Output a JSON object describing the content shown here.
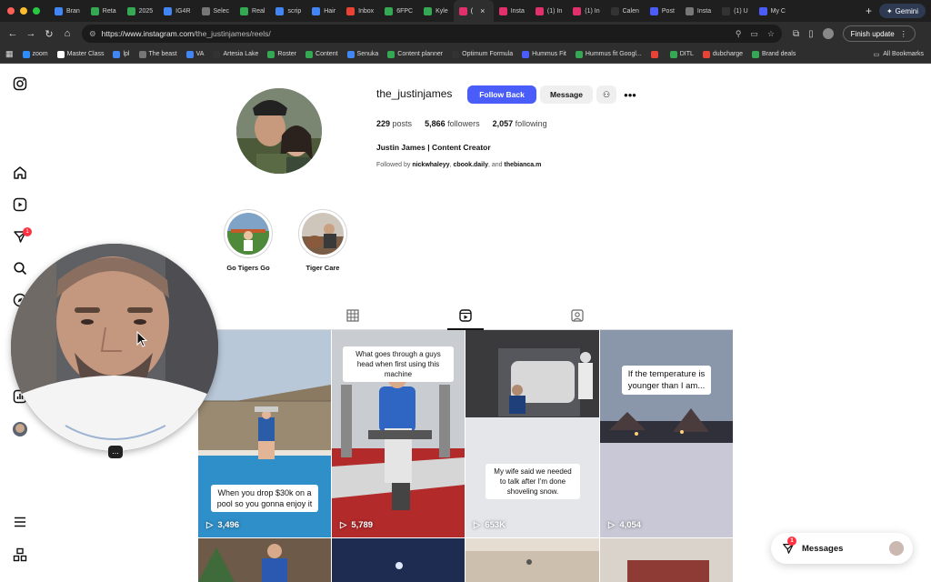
{
  "browser": {
    "tabs": [
      {
        "label": "Bran",
        "color": "#4285f4"
      },
      {
        "label": "Reta",
        "color": "#34a853"
      },
      {
        "label": "2025",
        "color": "#34a853"
      },
      {
        "label": "IG4R",
        "color": "#4285f4"
      },
      {
        "label": "Selec",
        "color": "#777777"
      },
      {
        "label": "Real",
        "color": "#34a853"
      },
      {
        "label": "scrip",
        "color": "#4285f4"
      },
      {
        "label": "Hair",
        "color": "#4285f4"
      },
      {
        "label": "Inbox",
        "color": "#ea4335"
      },
      {
        "label": "6FPC",
        "color": "#34a853"
      },
      {
        "label": "Kyle",
        "color": "#34a853"
      },
      {
        "label": "(",
        "color": "#e1306c"
      },
      {
        "label": "Insta",
        "color": "#e1306c"
      },
      {
        "label": "(1) In",
        "color": "#e1306c"
      },
      {
        "label": "(1) In",
        "color": "#e1306c"
      },
      {
        "label": "Calen",
        "color": "#333333"
      },
      {
        "label": "Post",
        "color": "#4a5df9"
      },
      {
        "label": "Insta",
        "color": "#777777"
      },
      {
        "label": "(1) U",
        "color": "#333333"
      },
      {
        "label": "My C",
        "color": "#4a5df9"
      }
    ],
    "active_tab_index": 11,
    "gemini_label": "Gemini",
    "url_prefix": "https://www.instagram.com",
    "url_path": "/the_justinjames/reels/",
    "finish_update_label": "Finish update",
    "bookmarks": [
      {
        "label": "zoom",
        "color": "#2d8cff"
      },
      {
        "label": "Master Class",
        "color": "#ffffff"
      },
      {
        "label": "lpl",
        "color": "#4285f4"
      },
      {
        "label": "The beast",
        "color": "#777777"
      },
      {
        "label": "VA",
        "color": "#4285f4"
      },
      {
        "label": "Artesia Lake",
        "color": "#333333"
      },
      {
        "label": "Roster",
        "color": "#34a853"
      },
      {
        "label": "Content",
        "color": "#34a853"
      },
      {
        "label": "Senuka",
        "color": "#4285f4"
      },
      {
        "label": "Content planner",
        "color": "#34a853"
      },
      {
        "label": "Optimum Formula",
        "color": "#333333"
      },
      {
        "label": "Hummus Fit",
        "color": "#4a5df9"
      },
      {
        "label": "Hummus fit Googl...",
        "color": "#34a853"
      },
      {
        "label": "",
        "color": "#ea4335"
      },
      {
        "label": "DITL",
        "color": "#34a853"
      },
      {
        "label": "dubcharge",
        "color": "#ea4335"
      },
      {
        "label": "Brand deals",
        "color": "#34a853"
      }
    ],
    "all_bookmarks_label": "All Bookmarks"
  },
  "profile": {
    "username": "the_justinjames",
    "follow_back_label": "Follow Back",
    "message_label": "Message",
    "posts_count": "229",
    "posts_label": "posts",
    "followers_count": "5,866",
    "followers_label": "followers",
    "following_count": "2,057",
    "following_label": "following",
    "full_name": "Justin James | Content Creator",
    "followed_by_prefix": "Followed by",
    "followed_by_1": "nickwhaleyy",
    "followed_by_2": "cbook.daily",
    "followed_by_and": ", and",
    "followed_by_3": "thebianca.m"
  },
  "highlights": [
    {
      "label": "Go Tigers Go"
    },
    {
      "label": "Tiger Care"
    }
  ],
  "reels": [
    {
      "views": "3,496",
      "caption": "When you drop $30k on a pool so you gonna enjoy it"
    },
    {
      "views": "5,789",
      "caption": "What goes through a guys head when first using this machine"
    },
    {
      "views": "653K",
      "caption": "My wife said we needed to talk after I'm done shoveling snow."
    },
    {
      "views": "4,054",
      "caption": "If the temperature is younger than I am..."
    }
  ],
  "sidebar_badge": "1",
  "messages": {
    "label": "Messages",
    "badge": "1"
  },
  "bubble_menu": "..."
}
